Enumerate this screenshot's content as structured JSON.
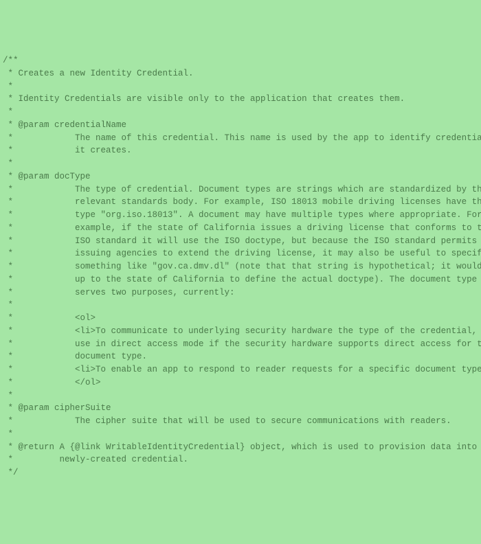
{
  "lines": [
    "/**",
    " * Creates a new Identity Credential.",
    " *",
    " * Identity Credentials are visible only to the application that creates them.",
    " *",
    " * @param credentialName",
    " *            The name of this credential. This name is used by the app to identify credentials",
    " *            it creates.",
    " *",
    " * @param docType",
    " *            The type of credential. Document types are strings which are standardized by the",
    " *            relevant standards body. For example, ISO 18013 mobile driving licenses have the",
    " *            type \"org.iso.18013\". A document may have multiple types where appropriate. For",
    " *            example, if the state of California issues a driving license that conforms to the",
    " *            ISO standard it will use the ISO doctype, but because the ISO standard permits",
    " *            issuing agencies to extend the driving license, it may also be useful to specify",
    " *            something like \"gov.ca.dmv.dl\" (note that that string is hypothetical; it would be",
    " *            up to the state of California to define the actual doctype). The document type",
    " *            serves two purposes, currently:",
    " *",
    " *            <ol>",
    " *            <li>To communicate to underlying security hardware the type of the credential, for",
    " *            use in direct access mode if the security hardware supports direct access for this",
    " *            document type.",
    " *            <li>To enable an app to respond to reader requests for a specific document type.",
    " *            </ol>",
    " *",
    " * @param cipherSuite",
    " *            The cipher suite that will be used to secure communications with readers.",
    " *",
    " * @return A {@link WritableIdentityCredential} object, which is used to provision data into the",
    " *         newly-created credential.",
    " */"
  ]
}
